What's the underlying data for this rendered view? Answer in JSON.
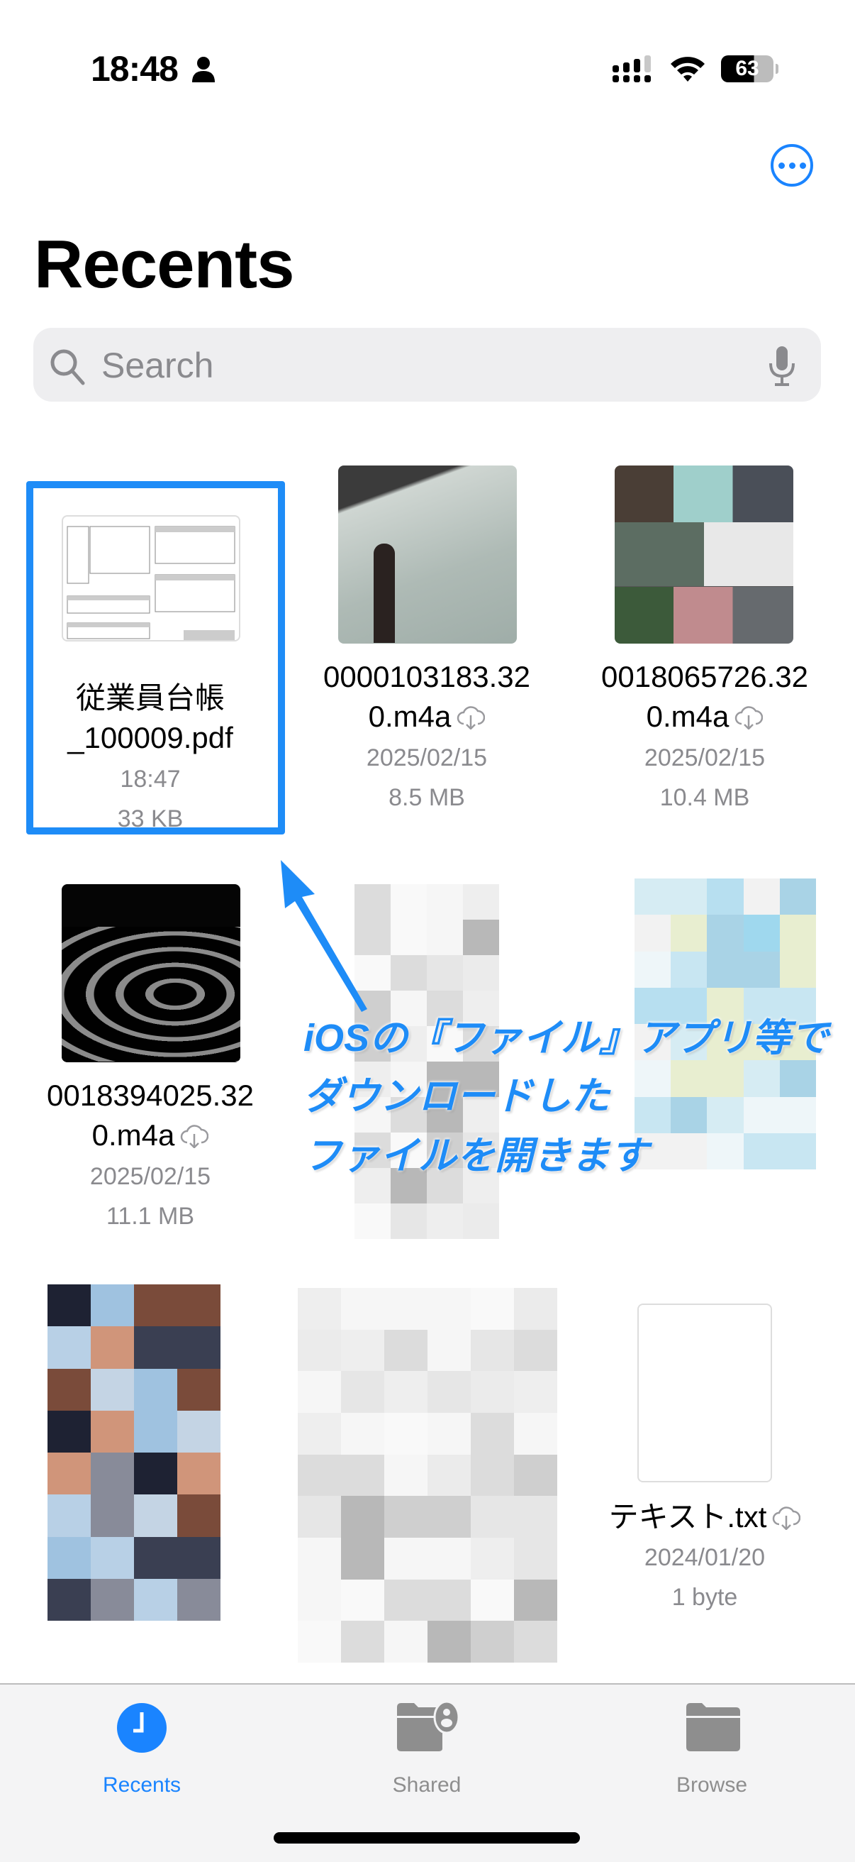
{
  "status_bar": {
    "time": "18:48",
    "battery": "63"
  },
  "header": {
    "title": "Recents",
    "more_icon": "ellipsis-circle-icon"
  },
  "search": {
    "placeholder": "Search"
  },
  "files": [
    {
      "name_line1": "従業員台帳",
      "name_line2": "_100009.pdf",
      "date": "18:47",
      "size": "33 KB",
      "cloud": false
    },
    {
      "name_line1": "0000103183.32",
      "name_line2": "0.m4a",
      "date": "2025/02/15",
      "size": "8.5 MB",
      "cloud": true
    },
    {
      "name_line1": "0018065726.32",
      "name_line2": "0.m4a",
      "date": "2025/02/15",
      "size": "10.4 MB",
      "cloud": true
    },
    {
      "name_line1": "0018394025.32",
      "name_line2": "0.m4a",
      "date": "2025/02/15",
      "size": "11.1 MB",
      "cloud": true
    },
    {
      "name_line1": "テキスト.txt",
      "date": "2024/01/20",
      "size": "1 byte",
      "cloud": true
    }
  ],
  "annotation": {
    "lines": [
      "iOSの『ファイル』アプリ等で",
      "ダウンロードした",
      "ファイルを開きます"
    ],
    "color": "#1e8cf7"
  },
  "tabbar": {
    "tabs": [
      {
        "label": "Recents",
        "icon": "clock-icon",
        "active": true
      },
      {
        "label": "Shared",
        "icon": "shared-folder-icon",
        "active": false
      },
      {
        "label": "Browse",
        "icon": "folder-icon",
        "active": false
      }
    ],
    "active_color": "#1a84ff",
    "inactive_color": "#8e8e8e"
  }
}
